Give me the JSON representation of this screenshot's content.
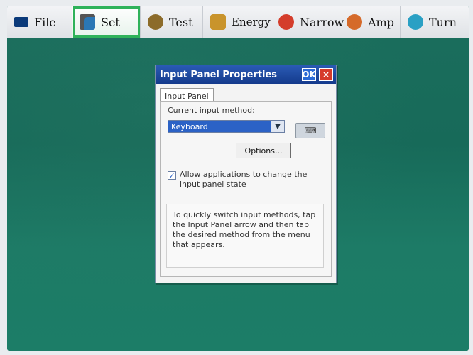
{
  "toolbar": {
    "items": [
      {
        "label": "File",
        "icon": "file-icon"
      },
      {
        "label": "Set",
        "icon": "settings-icon",
        "active": true
      },
      {
        "label": "Test",
        "icon": "test-icon"
      },
      {
        "label": "Energy",
        "icon": "energy-icon"
      },
      {
        "label": "Narrow",
        "icon": "narrow-icon"
      },
      {
        "label": "Amp",
        "icon": "amp-icon"
      },
      {
        "label": "Turn",
        "icon": "turn-icon"
      }
    ]
  },
  "dialog": {
    "title": "Input Panel Properties",
    "ok": "OK",
    "close": "×",
    "tab": "Input Panel",
    "current_input_label": "Current input method:",
    "input_method_value": "Keyboard",
    "options_label": "Options...",
    "checkbox_checked": true,
    "checkbox_label": "Allow applications to change the input panel state",
    "info_text": "To quickly switch input methods, tap the Input Panel arrow and then tap the desired method from the menu that appears."
  },
  "colors": {
    "desktop": "#176a59",
    "title_bar": "#143a8c",
    "selection": "#2b62c6",
    "active_outline": "#2fb25a"
  }
}
